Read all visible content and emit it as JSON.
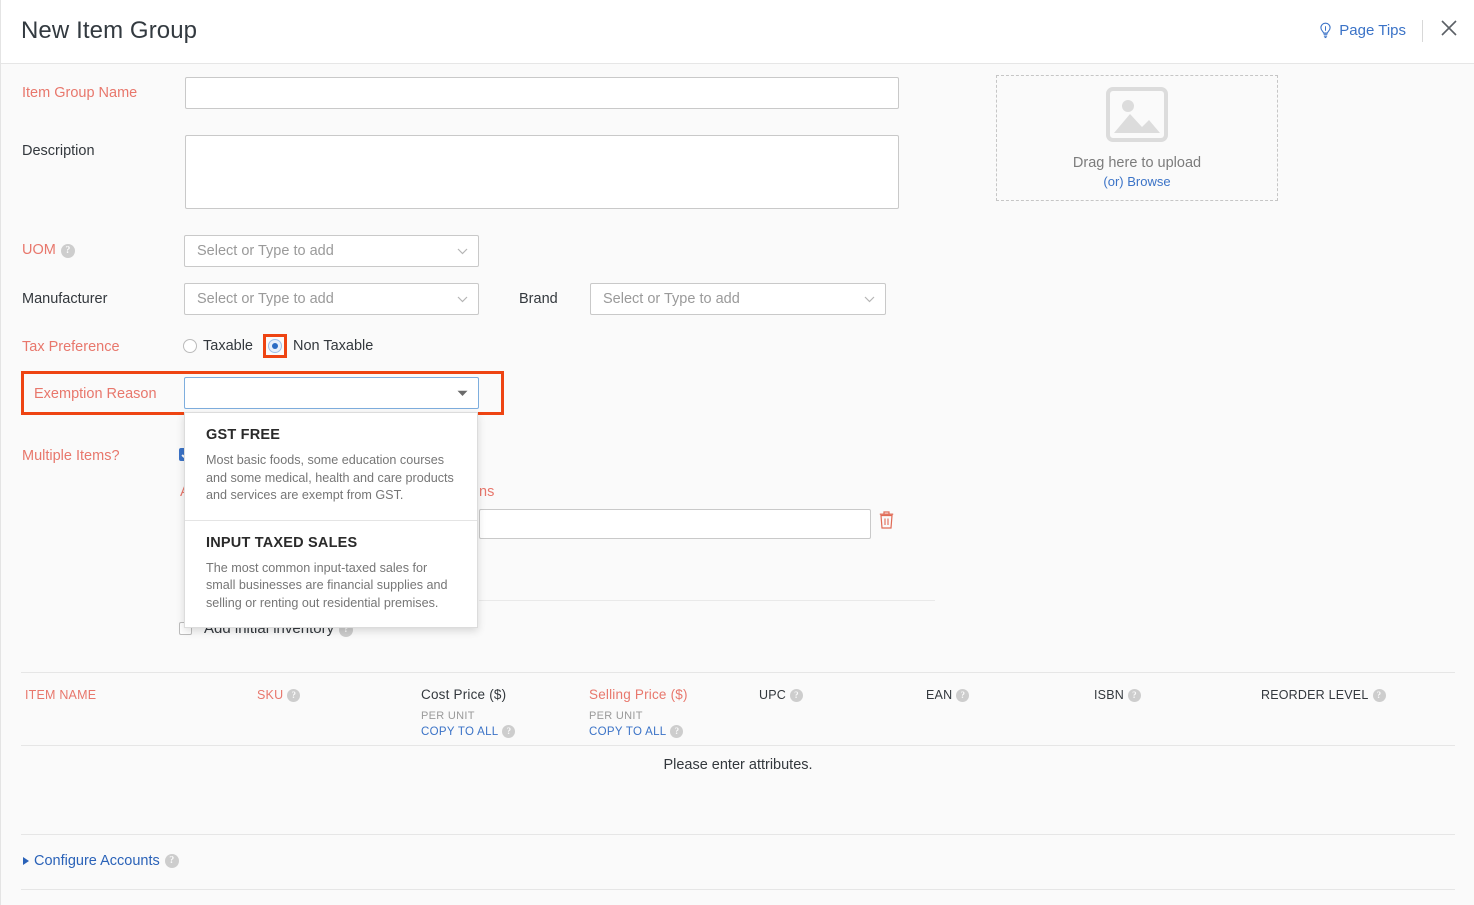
{
  "header": {
    "title": "New Item Group",
    "page_tips_label": "Page Tips",
    "page_tips_icon": "lightbulb-icon",
    "close_icon": "close-icon"
  },
  "upload": {
    "icon": "image-placeholder-icon",
    "drag_text": "Drag here to upload",
    "or_text": "(or) ",
    "browse_text": "Browse"
  },
  "form": {
    "item_group_name": {
      "label": "Item Group Name",
      "value": "",
      "placeholder": ""
    },
    "description": {
      "label": "Description",
      "value": "",
      "placeholder": ""
    },
    "uom": {
      "label": "UOM",
      "value": "Select or Type to add",
      "help": "?"
    },
    "manufacturer": {
      "label": "Manufacturer",
      "value": "Select or Type to add"
    },
    "brand": {
      "label": "Brand",
      "value": "Select or Type to add"
    },
    "tax_preference": {
      "label": "Tax Preference",
      "options": [
        {
          "label": "Taxable",
          "checked": false
        },
        {
          "label": "Non Taxable",
          "checked": true
        }
      ]
    },
    "exemption_reason": {
      "label": "Exemption Reason",
      "value": "",
      "placeholder": ""
    },
    "multiple_items": {
      "label": "Multiple Items?",
      "checked": true
    },
    "attributes_partial": "A",
    "options_partial": "ns",
    "attribute_value_input": {
      "value": ""
    },
    "add_initial_inventory": {
      "label": "Add initial inventory",
      "checked": false,
      "help": "?"
    }
  },
  "dropdown": {
    "items": [
      {
        "title": "GST FREE",
        "desc": "Most basic foods, some education courses and some medical, health and care products and services are exempt from GST."
      },
      {
        "title": "INPUT TAXED SALES",
        "desc": "The most common input-taxed sales for small businesses are financial supplies and selling or renting out residential premises."
      }
    ]
  },
  "table": {
    "columns": {
      "item_name": "ITEM NAME",
      "sku": "SKU",
      "cost_price": "Cost Price ($)",
      "selling_price": "Selling Price ($)",
      "upc": "UPC",
      "ean": "EAN",
      "isbn": "ISBN",
      "reorder_level": "REORDER LEVEL"
    },
    "per_unit": "PER UNIT",
    "copy_to_all": "COPY TO ALL",
    "empty_message": "Please enter attributes."
  },
  "footer": {
    "configure_accounts": "Configure Accounts"
  },
  "colors": {
    "required_red": "#e8776c",
    "highlight_orange": "#ee4412",
    "link_blue": "#3b73c7",
    "focus_blue": "#7eaede",
    "page_bg": "#fafafa"
  },
  "icons": {
    "trash": "trash-icon",
    "caret_down": "chevron-down-icon",
    "help": "help-circle-icon"
  }
}
